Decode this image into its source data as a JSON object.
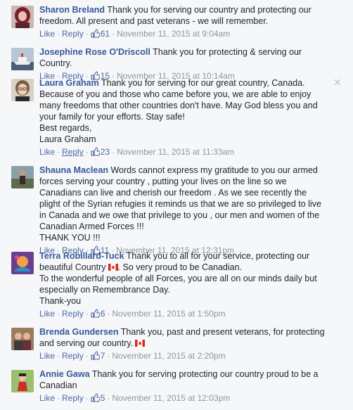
{
  "comments": [
    {
      "author": "Sharon Breland",
      "text": "Thank you for serving our country and protecting our freedom. All present and past veterans - we will remember.",
      "like_label": "Like",
      "reply_label": "Reply",
      "likes": "61",
      "timestamp": "November 11, 2015 at 9:04am",
      "avatar": "woman-red-hair-avatar"
    },
    {
      "author": "Josephine Rose O'Driscoll",
      "text": "Thank you for protecting & serving our Country.",
      "like_label": "Like",
      "reply_label": "Reply",
      "likes": "15",
      "timestamp": "November 11, 2015 at 10:14am",
      "avatar": "ship-avatar"
    },
    {
      "author": "Laura Graham",
      "text": "Thank you for serving for our great country, Canada. Because of you and those who came before you, we are able to enjoy many freedoms that other countries don't have. May God bless you and your family for your efforts. Stay safe!\nBest regards,\nLaura Graham",
      "like_label": "Like",
      "reply_label": "Reply",
      "likes": "23",
      "timestamp": "November 11, 2015 at 11:33am",
      "avatar": "woman-glasses-avatar"
    },
    {
      "author": "Shauna Maclean",
      "text": "Words cannot express my gratitude to you our armed forces serving your country , putting your lives on the line so we Canadians can live and cherish our freedom . As we see recently the plight of the Syrian refugies it reminds us that we are so privileged to live in Canada and we owe that privilege to you , our men and women of the Canadian Armed Forces !!!\nTHANK YOU !!!",
      "like_label": "Like",
      "reply_label": "Reply",
      "likes": "11",
      "timestamp": "November 11, 2015 at 12:31pm",
      "avatar": "person-outdoors-avatar"
    },
    {
      "author": "Terra Robillard-Tuck",
      "text_before_flag": "Thank you to all for your service, protecting our beautiful Country",
      "text_after_flag": ". So very proud to be Canadian.\nTo the wonderful people of all Forces, you are all on our minds daily but especially on Remembrance Day.\nThank-you",
      "like_label": "Like",
      "reply_label": "Reply",
      "likes": "6",
      "timestamp": "November 11, 2015 at 1:50pm",
      "avatar": "colorful-art-avatar"
    },
    {
      "author": "Brenda Gundersen",
      "text_before_flag": "Thank you, past and present veterans, for protecting and serving our country.",
      "like_label": "Like",
      "reply_label": "Reply",
      "likes": "7",
      "timestamp": "November 11, 2015 at 2:20pm",
      "avatar": "couple-avatar"
    },
    {
      "author": "Annie Gawa",
      "text": "Thank you for serving protecting our country proud to be a Canadian",
      "like_label": "Like",
      "reply_label": "Reply",
      "likes": "5",
      "timestamp": "November 11, 2015 at 12:03pm",
      "avatar": "child-red-avatar"
    }
  ],
  "close_glyph": "✕",
  "colors": {
    "name": "#365899",
    "link": "#4b67a1",
    "meta": "#90949c",
    "background": "#f6f7f9"
  }
}
